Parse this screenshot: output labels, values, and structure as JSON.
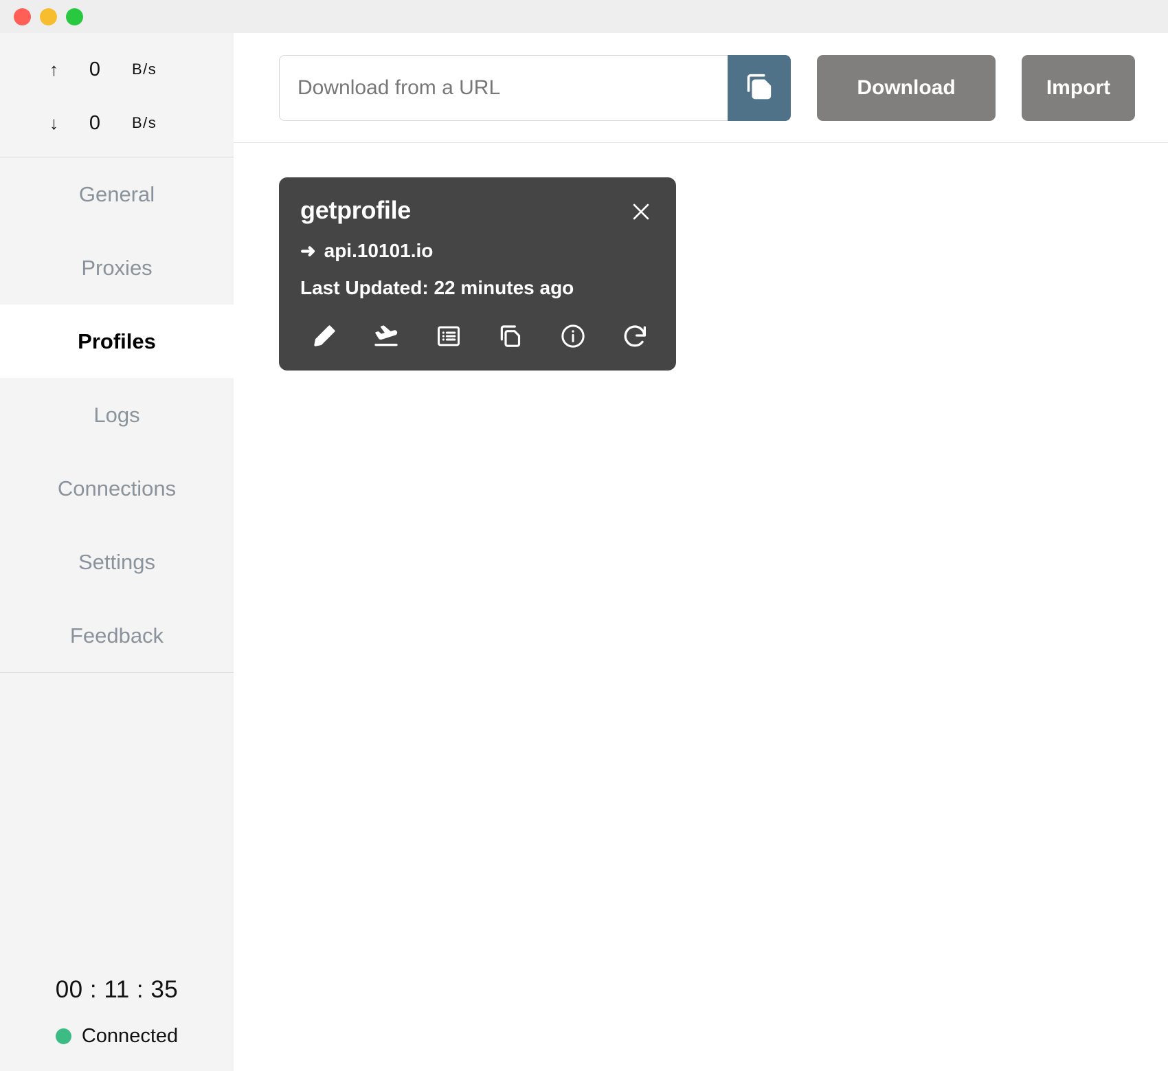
{
  "window": {
    "traffic_lights": [
      {
        "name": "close",
        "color": "#ff5f57"
      },
      {
        "name": "minimize",
        "color": "#f7bd2e"
      },
      {
        "name": "zoom",
        "color": "#28c840"
      }
    ]
  },
  "sidebar": {
    "speeds": [
      {
        "icon": "arrow-up",
        "arrow": "↑",
        "value": "0",
        "unit": "B/s"
      },
      {
        "icon": "arrow-down",
        "arrow": "↓",
        "value": "0",
        "unit": "B/s"
      }
    ],
    "nav_items": [
      {
        "label": "General",
        "active": false
      },
      {
        "label": "Proxies",
        "active": false
      },
      {
        "label": "Profiles",
        "active": true
      },
      {
        "label": "Logs",
        "active": false
      },
      {
        "label": "Connections",
        "active": false
      },
      {
        "label": "Settings",
        "active": false
      },
      {
        "label": "Feedback",
        "active": false
      }
    ],
    "footer": {
      "timer": "00 : 11 : 35",
      "status_label": "Connected",
      "status_color": "#3cbb85"
    }
  },
  "toolbar": {
    "url_placeholder": "Download from a URL",
    "url_value": "",
    "paste_icon": "copy-paste-icon",
    "download_label": "Download",
    "import_label": "Import",
    "accent_paste": "#4f7289",
    "button_bg": "#807f7d"
  },
  "profiles": [
    {
      "title": "getprofile",
      "url_arrow": "➜",
      "url": "api.10101.io",
      "last_updated": "Last Updated: 22 minutes ago",
      "card_bg": "#454545",
      "actions": [
        {
          "name": "edit-icon",
          "title": "Edit"
        },
        {
          "name": "plane-landing-icon",
          "title": "Latency test"
        },
        {
          "name": "list-icon",
          "title": "Proxies list"
        },
        {
          "name": "copy-icon",
          "title": "Copy link"
        },
        {
          "name": "info-icon",
          "title": "Info"
        },
        {
          "name": "refresh-icon",
          "title": "Update"
        }
      ]
    }
  ]
}
